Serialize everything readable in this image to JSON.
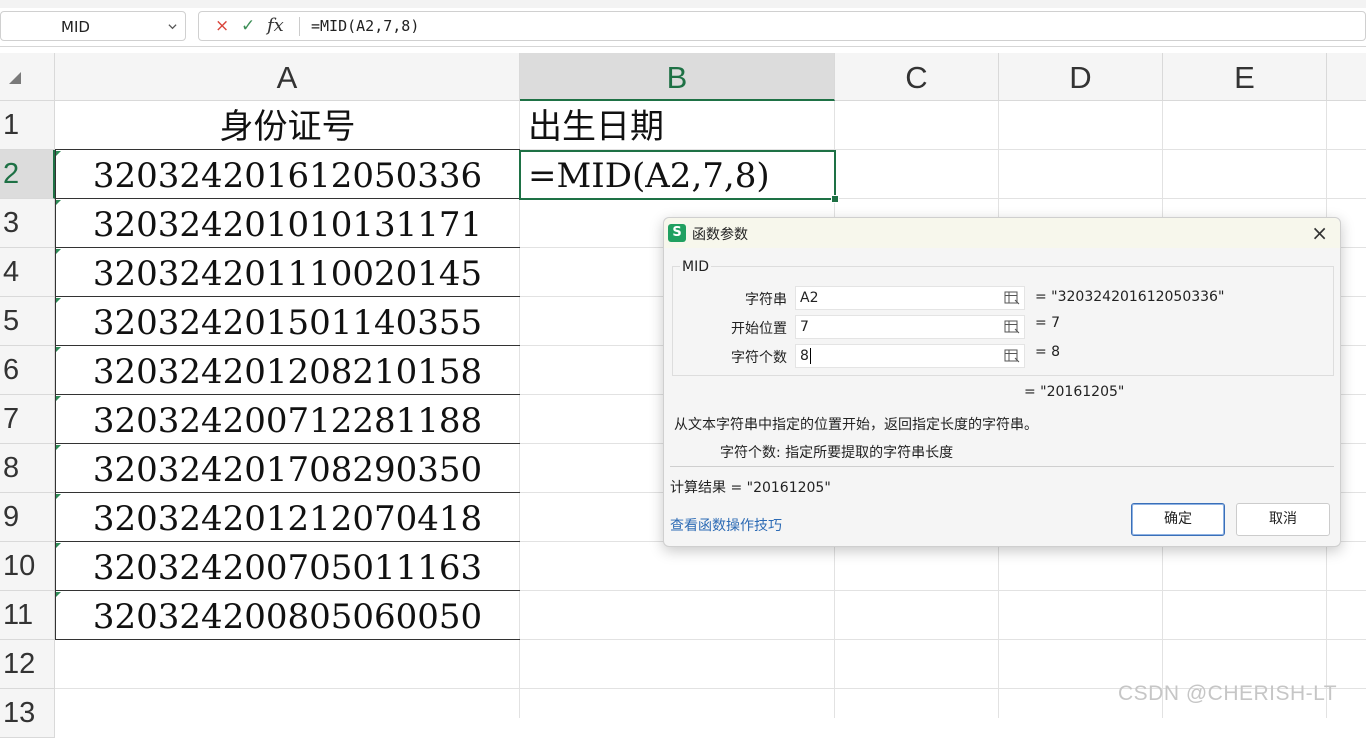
{
  "formula_bar": {
    "name_box": "MID",
    "cancel_icon": "×",
    "confirm_icon": "✓",
    "fx_label": "fx",
    "formula": "=MID(A2,7,8)"
  },
  "columns": [
    "A",
    "B",
    "C",
    "D",
    "E"
  ],
  "rows": [
    "1",
    "2",
    "3",
    "4",
    "5",
    "6",
    "7",
    "8",
    "9",
    "10",
    "11",
    "12",
    "13"
  ],
  "cells": {
    "A1": "身份证号",
    "B1": "出生日期",
    "A2": "320324201612050336",
    "B2": "=MID(A2,7,8)",
    "A3": "320324201010131171",
    "A4": "320324201110020145",
    "A5": "320324201501140355",
    "A6": "320324201208210158",
    "A7": "320324200712281188",
    "A8": "320324201708290350",
    "A9": "320324201212070418",
    "A10": "320324200705011163",
    "A11": "320324200805060050"
  },
  "dialog": {
    "logo": "S",
    "title": "函数参数",
    "close": "×",
    "function_name": "MID",
    "params": [
      {
        "label": "字符串",
        "value": "A2",
        "result": "= \"320324201612050336\""
      },
      {
        "label": "开始位置",
        "value": "7",
        "result": "= 7"
      },
      {
        "label": "字符个数",
        "value": "8",
        "result": "= 8"
      }
    ],
    "total_result": "= \"20161205\"",
    "description": "从文本字符串中指定的位置开始，返回指定长度的字符串。",
    "arg_description": "字符个数:  指定所要提取的字符串长度",
    "calc_result": "计算结果  =  \"20161205\"",
    "help_link": "查看函数操作技巧",
    "ok_label": "确定",
    "cancel_label": "取消"
  },
  "watermark": "CSDN @CHERISH-LT",
  "colors": {
    "accent_green": "#1e7145",
    "link_blue": "#2d6bb5",
    "cancel_red": "#d9443a"
  }
}
